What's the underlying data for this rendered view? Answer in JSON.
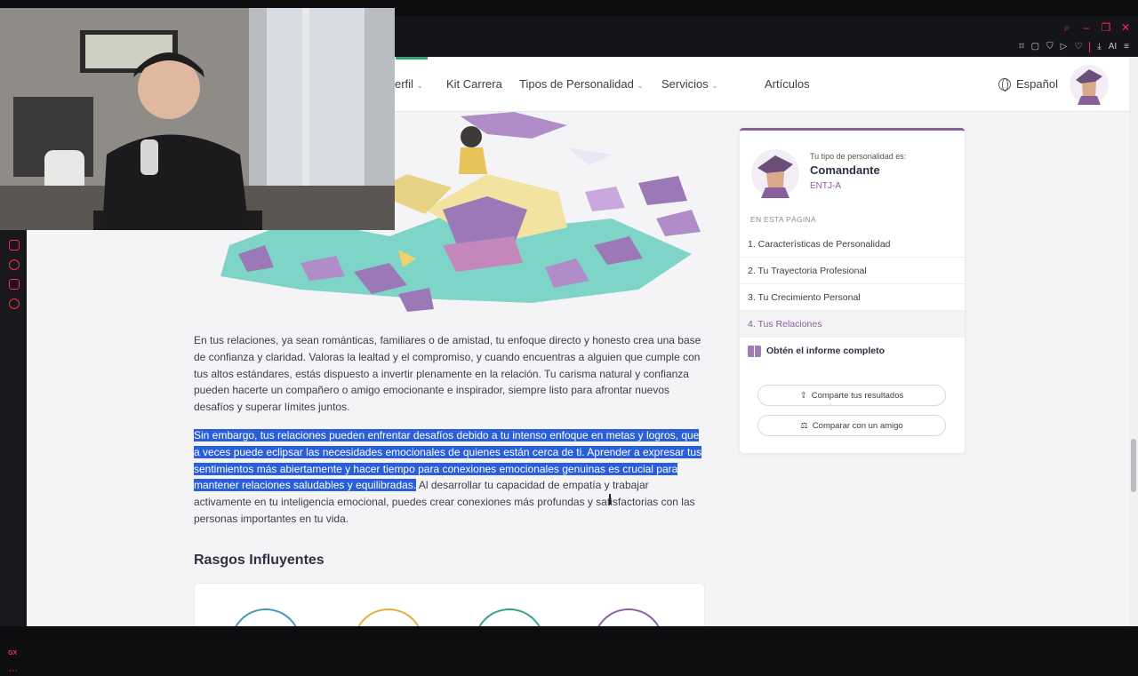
{
  "nav": {
    "items": [
      {
        "label": "erfil",
        "chevron": true
      },
      {
        "label": "Kit Carrera",
        "chevron": false
      },
      {
        "label": "Tipos de Personalidad",
        "chevron": true
      },
      {
        "label": "Servicios",
        "chevron": true
      },
      {
        "label": "Artículos",
        "chevron": false
      }
    ],
    "language": "Español"
  },
  "article": {
    "paragraph1": "En tus relaciones, ya sean románticas, familiares o de amistad, tu enfoque directo y honesto crea una base de confianza y claridad. Valoras la lealtad y el compromiso, y cuando encuentras a alguien que cumple con tus altos estándares, estás dispuesto a invertir plenamente en la relación. Tu carisma natural y confianza pueden hacerte un compañero o amigo emocionante e inspirador, siempre listo para afrontar nuevos desafíos y superar límites juntos.",
    "paragraph2_selected": "Sin embargo, tus relaciones pueden enfrentar desafíos debido a tu intenso enfoque en metas y logros, que a veces puede eclipsar las necesidades emocionales de quienes están cerca de ti. Aprender a expresar tus sentimientos más abiertamente y hacer tiempo para conexiones emocionales genuinas es crucial para mantener relaciones saludables y equilibradas.",
    "paragraph2_rest": " Al desarrollar tu capacidad de empatía y trabajar activamente en tu inteligencia emocional, puedes crear conexiones más profundas y satisfactorias con las personas importantes en tu vida.",
    "heading": "Rasgos Influyentes"
  },
  "sidebar": {
    "type_label": "Tu tipo de personalidad es:",
    "type_name": "Comandante",
    "type_code": "ENTJ-A",
    "section_label": "EN ESTA PÁGINA",
    "links": [
      {
        "label": "1. Características de Personalidad",
        "active": false
      },
      {
        "label": "2. Tu Trayectoria Profesional",
        "active": false
      },
      {
        "label": "3. Tu Crecimiento Personal",
        "active": false
      },
      {
        "label": "4. Tus Relaciones",
        "active": true
      }
    ],
    "report_label": "Obtén el informe completo",
    "share_button": "Comparte tus resultados",
    "compare_button": "Comparar con un amigo"
  },
  "browser": {
    "toolbar_ai": "AI",
    "sidebar_gx": "GX"
  },
  "colors": {
    "accent_purple": "#88619a",
    "selection_blue": "#2b5fd9",
    "browser_accent": "#ff2b55",
    "trait_rings": [
      "#4298b4",
      "#e4ae3a",
      "#33a474",
      "#88619a"
    ]
  }
}
